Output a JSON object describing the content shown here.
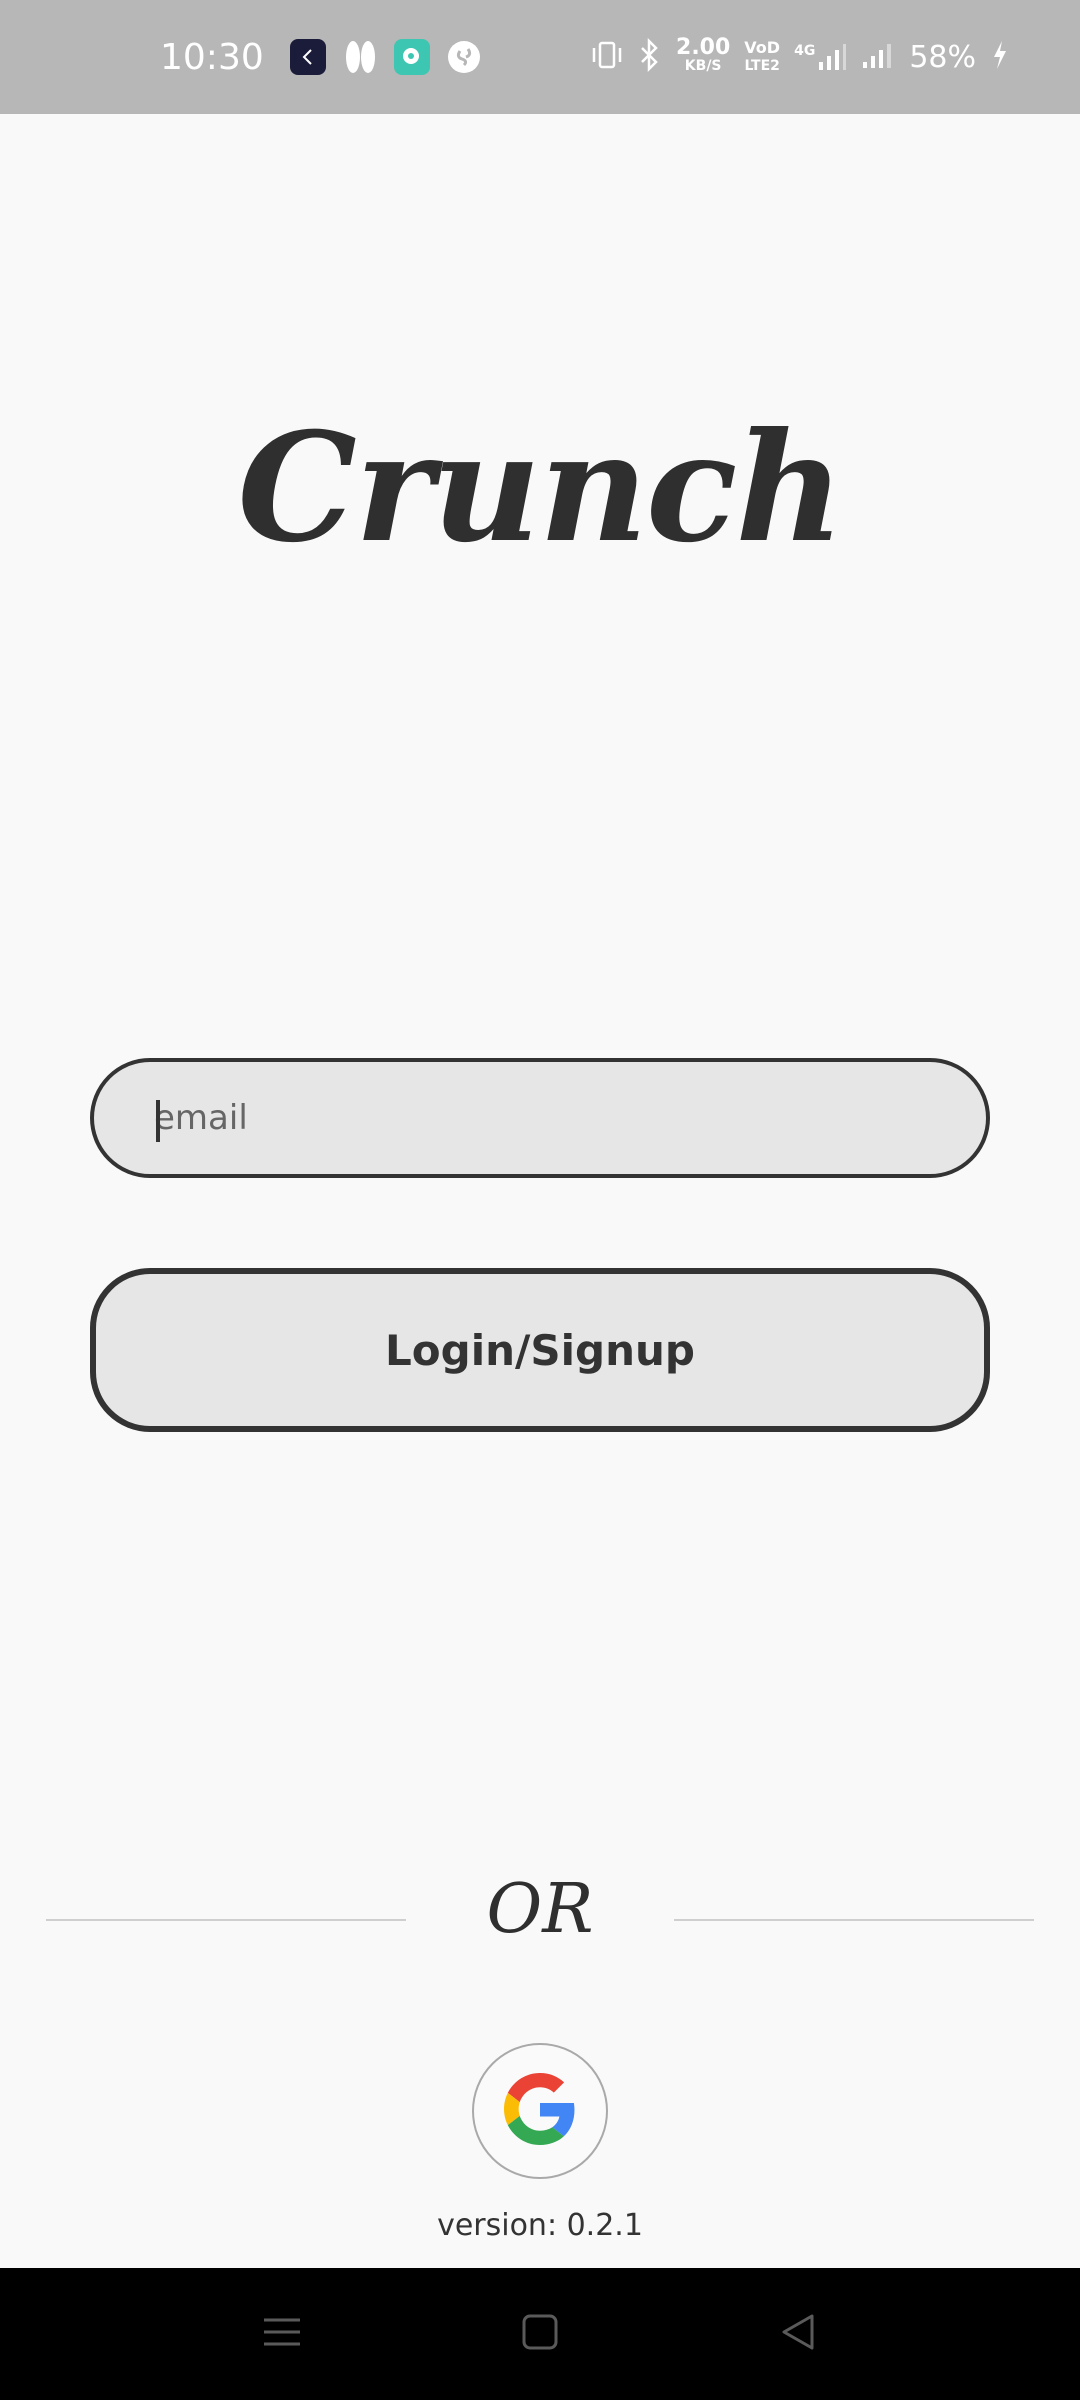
{
  "status_bar": {
    "time": "10:30",
    "network_speed_value": "2.00",
    "network_speed_unit": "KB/S",
    "volte_top": "VoD",
    "volte_bottom": "LTE2",
    "network_type": "4G",
    "battery_percent": "58%",
    "notification_icons": [
      "app-clock-icon",
      "app-pill-icon",
      "app-chat-icon",
      "shazam-icon"
    ]
  },
  "app": {
    "logo_text": "Crunch"
  },
  "form": {
    "email_placeholder": "email",
    "email_value": "",
    "login_label": "Login/Signup"
  },
  "divider": {
    "or_text": "OR"
  },
  "google": {
    "icon": "google-icon",
    "colors": {
      "red": "#EA4335",
      "yellow": "#FBBC05",
      "green": "#34A853",
      "blue": "#4285F4"
    }
  },
  "footer": {
    "version_text": "version: 0.2.1"
  },
  "nav": {
    "icons": [
      "menu-icon",
      "home-icon",
      "back-icon"
    ]
  },
  "colors": {
    "background": "#f9f9f9",
    "text_dark": "#333333",
    "field_fill": "#e6e6e6",
    "status_bar": "#b7b7b7",
    "nav_bar": "#000000"
  }
}
